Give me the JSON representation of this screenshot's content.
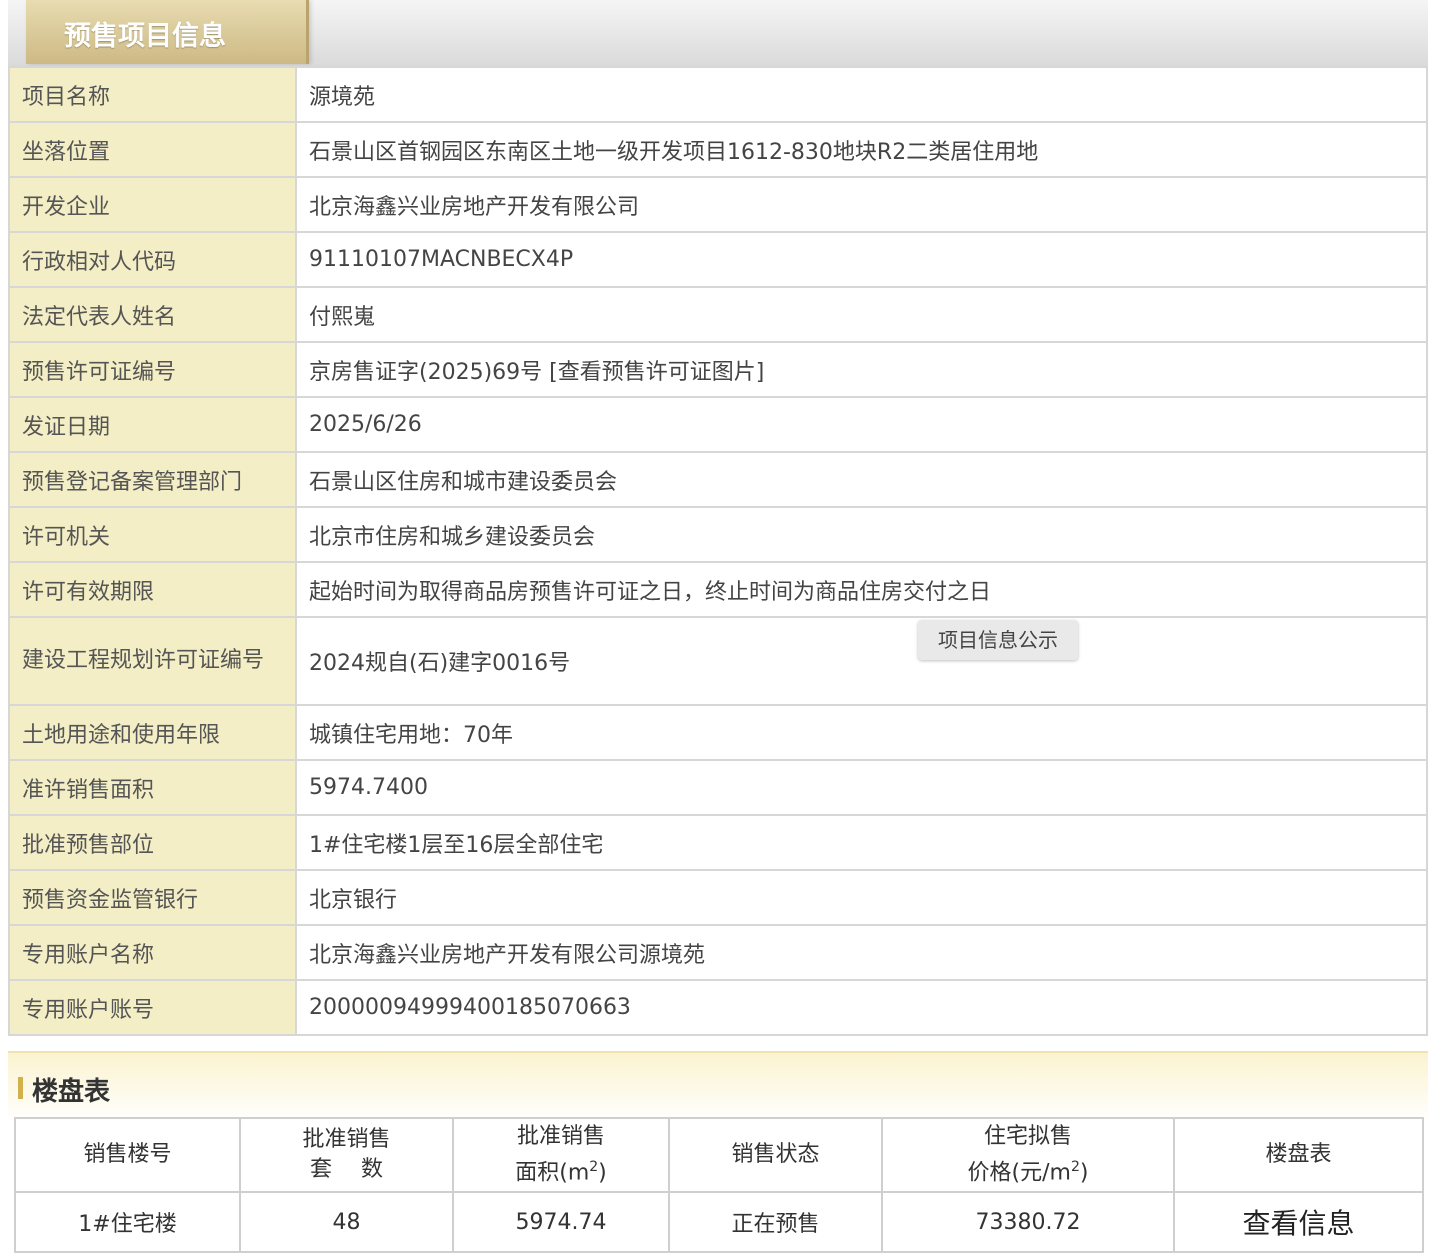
{
  "header": {
    "tab_title": "预售项目信息"
  },
  "info_rows": [
    {
      "label": "项目名称",
      "value": "源境苑"
    },
    {
      "label": "坐落位置",
      "value": "石景山区首钢园区东南区土地一级开发项目1612-830地块R2二类居住用地"
    },
    {
      "label": "开发企业",
      "value": "北京海鑫兴业房地产开发有限公司"
    },
    {
      "label": "行政相对人代码",
      "value": "91110107MACNBECX4P"
    },
    {
      "label": "法定代表人姓名",
      "value": "付熙嵬"
    },
    {
      "label": "预售许可证编号",
      "value": "京房售证字(2025)69号",
      "link": "[查看预售许可证图片]"
    },
    {
      "label": "发证日期",
      "value": "2025/6/26"
    },
    {
      "label": "预售登记备案管理部门",
      "value": "石景山区住房和城市建设委员会"
    },
    {
      "label": "许可机关",
      "value": "北京市住房和城乡建设委员会"
    },
    {
      "label": "许可有效期限",
      "value": "起始时间为取得商品房预售许可证之日，终止时间为商品住房交付之日"
    },
    {
      "label": "建设工程规划许可证编号",
      "value": "2024规自(石)建字0016号"
    },
    {
      "label": "土地用途和使用年限",
      "value": "城镇住宅用地：70年"
    },
    {
      "label": "准许销售面积",
      "value": "5974.7400"
    },
    {
      "label": "批准预售部位",
      "value": "1#住宅楼1层至16层全部住宅"
    },
    {
      "label": "预售资金监管银行",
      "value": "北京银行"
    },
    {
      "label": "专用账户名称",
      "value": "北京海鑫兴业房地产开发有限公司源境苑"
    },
    {
      "label": "专用账户账号",
      "value": "20000094999400185070663"
    }
  ],
  "tooltip": "项目信息公示",
  "building_section": {
    "title": "楼盘表",
    "headers": {
      "h1": "销售楼号",
      "h2a": "批准销售",
      "h2b": "套　 数",
      "h3a": "批准销售",
      "h3b": "面积(m",
      "h3sup": "2",
      "h3c": ")",
      "h4": "销售状态",
      "h5a": "住宅拟售",
      "h5b": "价格(元/m",
      "h5sup": "2",
      "h5c": ")",
      "h6": "楼盘表"
    },
    "rows": [
      {
        "building": "1#住宅楼",
        "units": "48",
        "area": "5974.74",
        "status": "正在预售",
        "price": "73380.72",
        "action": "查看信息"
      }
    ]
  }
}
